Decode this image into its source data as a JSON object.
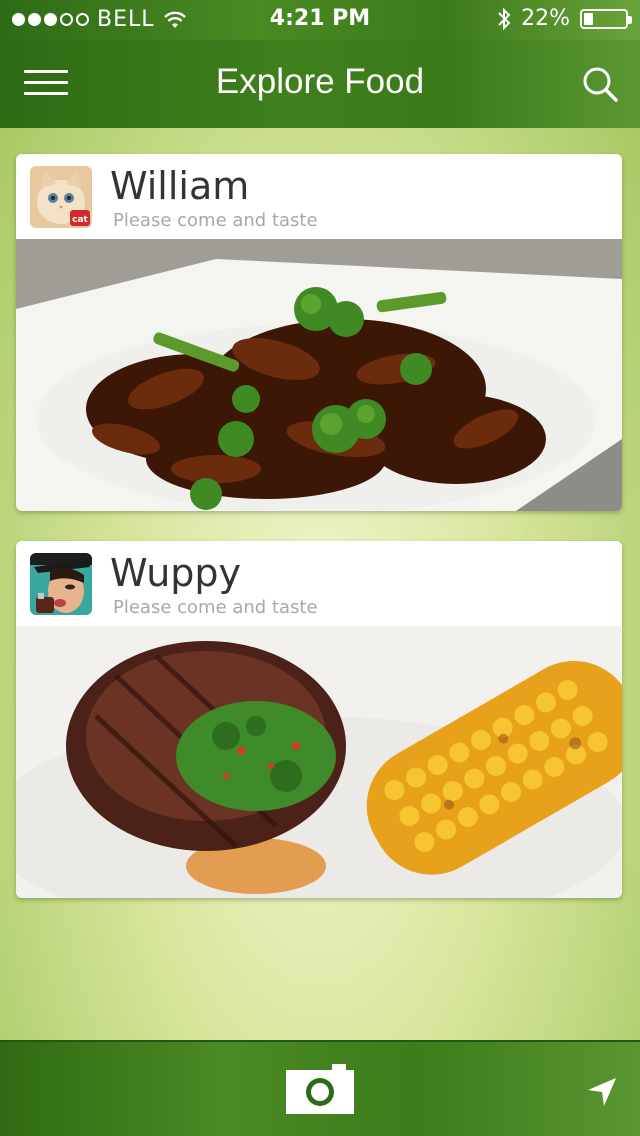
{
  "status_bar": {
    "carrier": "BELL",
    "time": "4:21 PM",
    "battery": "22%",
    "battery_level": 0.22,
    "signal_bars": 3,
    "icons": [
      "signal-dots-icon",
      "wifi-icon",
      "bluetooth-icon",
      "battery-icon"
    ]
  },
  "nav": {
    "title": "Explore Food",
    "left_icon": "hamburger-menu-icon",
    "right_icon": "search-icon"
  },
  "feed": {
    "posts": [
      {
        "user": "William",
        "subtitle": "Please come and taste",
        "avatar_icon": "cat-avatar",
        "photo": "beef-broccoli-photo"
      },
      {
        "user": "Wuppy",
        "subtitle": "Please come and taste",
        "avatar_icon": "woman-avatar",
        "photo": "steak-corn-photo"
      }
    ]
  },
  "bottom_bar": {
    "center_icon": "camera-icon",
    "right_icon": "location-arrow-icon"
  },
  "colors": {
    "bar_green": "#3f7f1c",
    "background_light": "#f3f7d2",
    "text_dark": "#333333",
    "text_muted": "#a8a8a8"
  }
}
